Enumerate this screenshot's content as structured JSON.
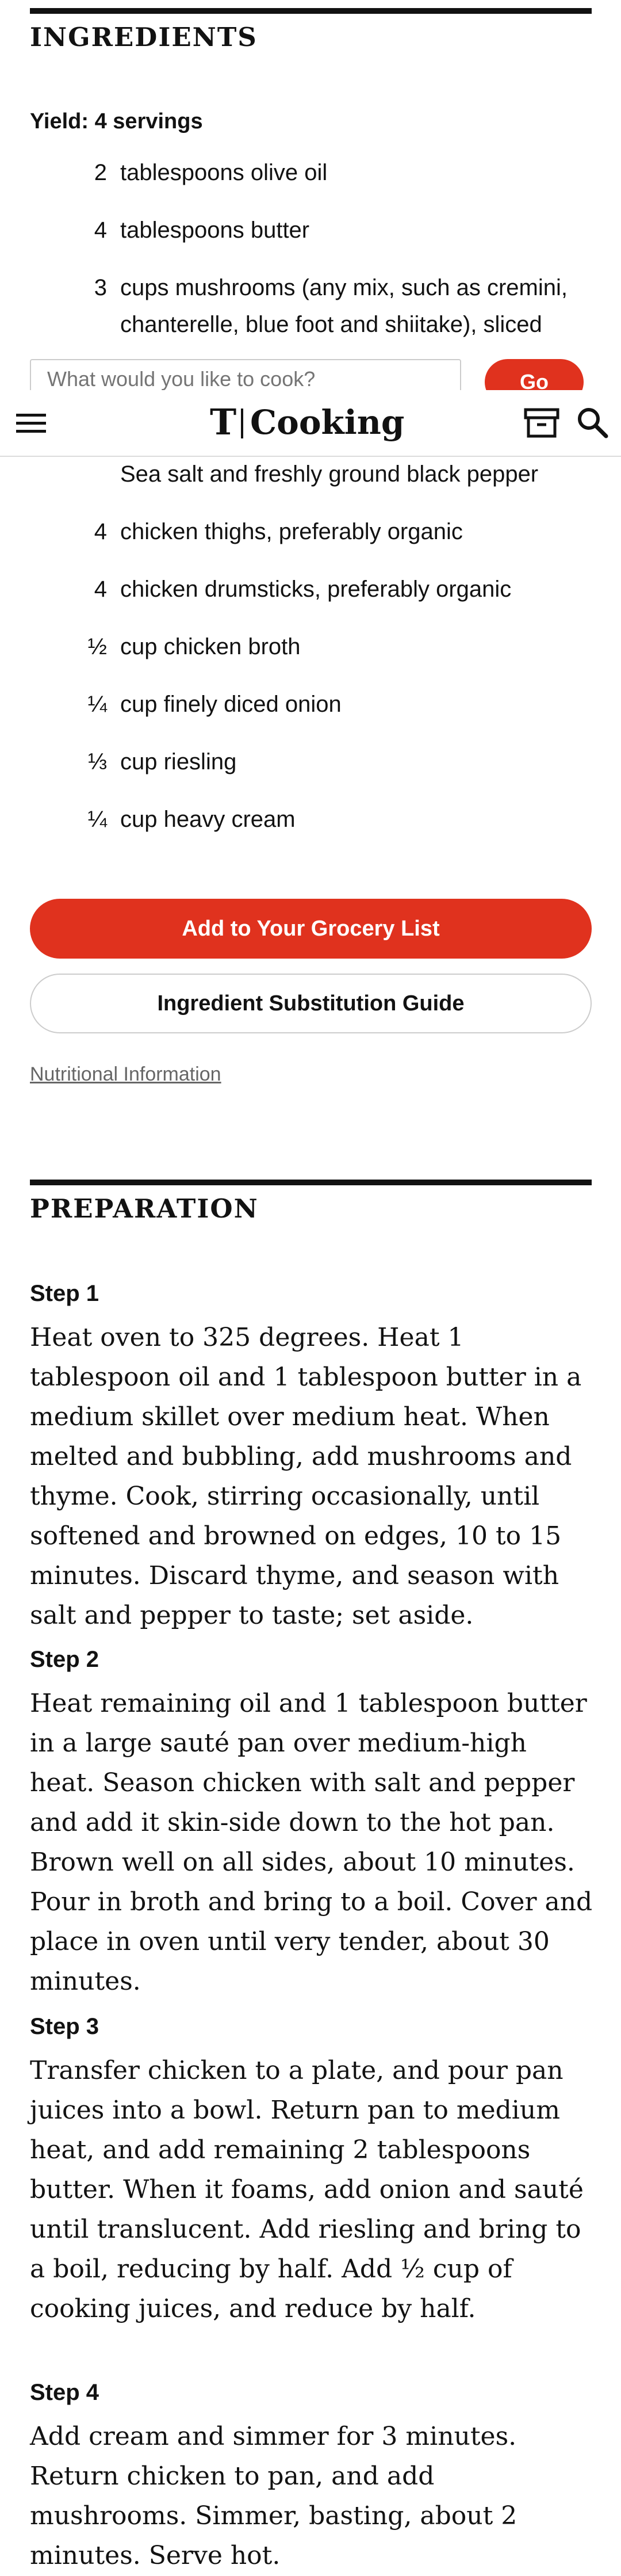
{
  "ingredients": {
    "title": "INGREDIENTS",
    "yield": "Yield: 4 servings",
    "items": [
      {
        "qty": "2",
        "text": "tablespoons olive oil"
      },
      {
        "qty": "4",
        "text": "tablespoons butter"
      },
      {
        "qty": "3",
        "text": "cups mushrooms (any mix, such as cremini, chanterelle, blue foot and shiitake), sliced"
      },
      {
        "qty": "",
        "text": "Sea salt and freshly ground black pepper"
      },
      {
        "qty": "4",
        "text": "chicken thighs, preferably organic"
      },
      {
        "qty": "4",
        "text": "chicken drumsticks, preferably organic"
      },
      {
        "qty": "½",
        "text": "cup chicken broth"
      },
      {
        "qty": "¼",
        "text": "cup finely diced onion"
      },
      {
        "qty": "⅓",
        "text": "cup riesling"
      },
      {
        "qty": "¼",
        "text": "cup heavy cream"
      }
    ],
    "grocery_button": "Add to Your Grocery List",
    "substitution_button": "Ingredient Substitution Guide",
    "nutrition_link": "Nutritional Information"
  },
  "search": {
    "placeholder": "What would you like to cook?",
    "go_label": "Go"
  },
  "header": {
    "logo_mark": "T",
    "logo_text": "Cooking",
    "icons": [
      "hamburger-menu-icon",
      "recipe-box-icon",
      "search-icon"
    ]
  },
  "preparation": {
    "title": "PREPARATION",
    "steps": [
      {
        "label": "Step 1",
        "text": "Heat oven to 325 degrees. Heat 1 tablespoon oil and 1 tablespoon butter in a medium skillet over medium heat. When melted and bubbling, add mushrooms and thyme. Cook, stirring occasionally, until softened and browned on edges, 10 to 15 minutes. Discard thyme, and season with salt and pepper to taste; set aside."
      },
      {
        "label": "Step 2",
        "text": "Heat remaining oil and 1 tablespoon butter in a large sauté pan over medium-high heat. Season chicken with salt and pepper and add it skin-side down to the hot pan. Brown well on all sides, about 10 minutes. Pour in broth and bring to a boil. Cover and place in oven until very tender, about 30 minutes."
      },
      {
        "label": "Step 3",
        "text": "Transfer chicken to a plate, and pour pan juices into a bowl. Return pan to medium heat, and add remaining 2 tablespoons butter. When it foams, add onion and sauté until translucent. Add riesling and bring to a boil, reducing by half. Add ½ cup of cooking juices, and reduce by half."
      },
      {
        "label": "Step 4",
        "text": "Add cream and simmer for 3 minutes. Return chicken to pan, and add mushrooms. Simmer, basting, about 2 minutes. Serve hot."
      }
    ]
  },
  "colors": {
    "accent": "#e0321e",
    "text": "#121212",
    "muted": "#666666"
  }
}
